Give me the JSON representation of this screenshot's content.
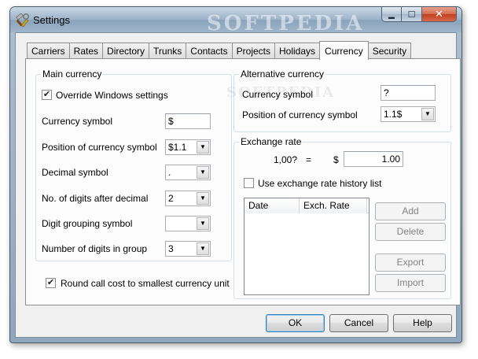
{
  "window": {
    "title": "Settings",
    "watermark": "SOFTPEDIA",
    "controls": {
      "minimize": "▬",
      "maximize": "☐",
      "close": "✕"
    }
  },
  "tabs": [
    {
      "label": "Carriers",
      "active": false
    },
    {
      "label": "Rates",
      "active": false
    },
    {
      "label": "Directory",
      "active": false
    },
    {
      "label": "Trunks",
      "active": false
    },
    {
      "label": "Contacts",
      "active": false
    },
    {
      "label": "Projects",
      "active": false
    },
    {
      "label": "Holidays",
      "active": false
    },
    {
      "label": "Currency",
      "active": true
    },
    {
      "label": "Security",
      "active": false
    }
  ],
  "main_currency": {
    "group_label": "Main currency",
    "override_label": "Override Windows settings",
    "override_checked": true,
    "currency_symbol_label": "Currency symbol",
    "currency_symbol_value": "$",
    "position_label": "Position of currency symbol",
    "position_value": "$1.1",
    "decimal_label": "Decimal symbol",
    "decimal_value": ".",
    "digits_after_decimal_label": "No. of digits after decimal",
    "digits_after_decimal_value": "2",
    "grouping_symbol_label": "Digit grouping symbol",
    "grouping_symbol_value": "",
    "digits_in_group_label": "Number of digits in group",
    "digits_in_group_value": "3"
  },
  "round_cost": {
    "label": "Round call cost to smallest currency unit",
    "checked": true
  },
  "alt_currency": {
    "group_label": "Alternative currency",
    "watermark": "SOFTPEDIA",
    "currency_symbol_label": "Currency symbol",
    "currency_symbol_value": "?",
    "position_label": "Position of currency symbol",
    "position_value": "1.1$"
  },
  "exchange_rate": {
    "group_label": "Exchange rate",
    "left_amount": "1,00?",
    "equals": "=",
    "dollar": "$",
    "rate_value": "1.00",
    "history_label": "Use exchange rate history list",
    "history_checked": false,
    "columns": [
      "Date",
      "Exch. Rate"
    ],
    "add_label": "Add",
    "delete_label": "Delete",
    "export_label": "Export",
    "import_label": "Import"
  },
  "footer": {
    "ok_label": "OK",
    "cancel_label": "Cancel",
    "help_label": "Help"
  },
  "glyphs": {
    "check": "✔",
    "dropdown": "▼"
  }
}
